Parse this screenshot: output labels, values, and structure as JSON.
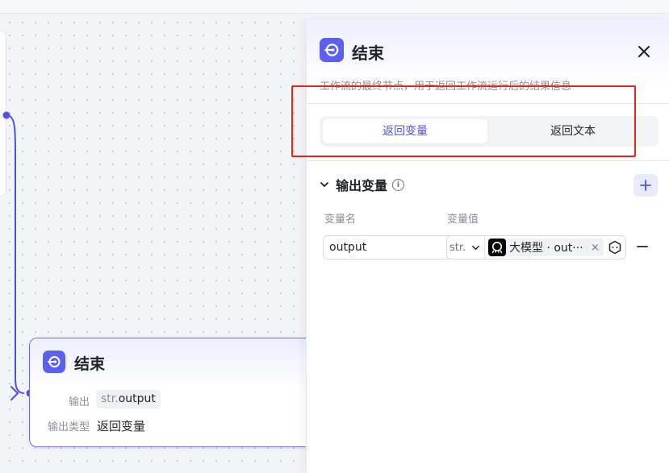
{
  "colors": {
    "accent": "#5b5ff3",
    "accent_text": "#4e50e8",
    "highlight_border": "#e8241f",
    "canvas_bg": "#f3f4f7"
  },
  "canvas": {
    "end_node": {
      "icon": "end-node-icon",
      "title": "结束",
      "output_label": "输出",
      "output_type_tag": "str.",
      "output_value": "output",
      "output_type_label": "输出类型",
      "output_type_value": "返回变量"
    }
  },
  "panel": {
    "icon": "end-node-icon",
    "title": "结束",
    "description": "工作流的最终节点，用于返回工作流运行后的结果信息",
    "close_icon": "close-icon",
    "mode_tabs": [
      {
        "label": "返回变量",
        "active": true
      },
      {
        "label": "返回文本",
        "active": false
      }
    ],
    "output_section": {
      "title": "输出变量",
      "info_icon": "info-icon",
      "add_icon": "plus-icon",
      "col_name": "变量名",
      "col_value": "变量值",
      "rows": [
        {
          "name": "output",
          "type": "str.",
          "ref_source": "大模型",
          "ref_text": "大模型 · out···",
          "ref_close": "×",
          "var_icon": "variable-picker-icon",
          "remove_icon": "minus-icon"
        }
      ]
    }
  }
}
